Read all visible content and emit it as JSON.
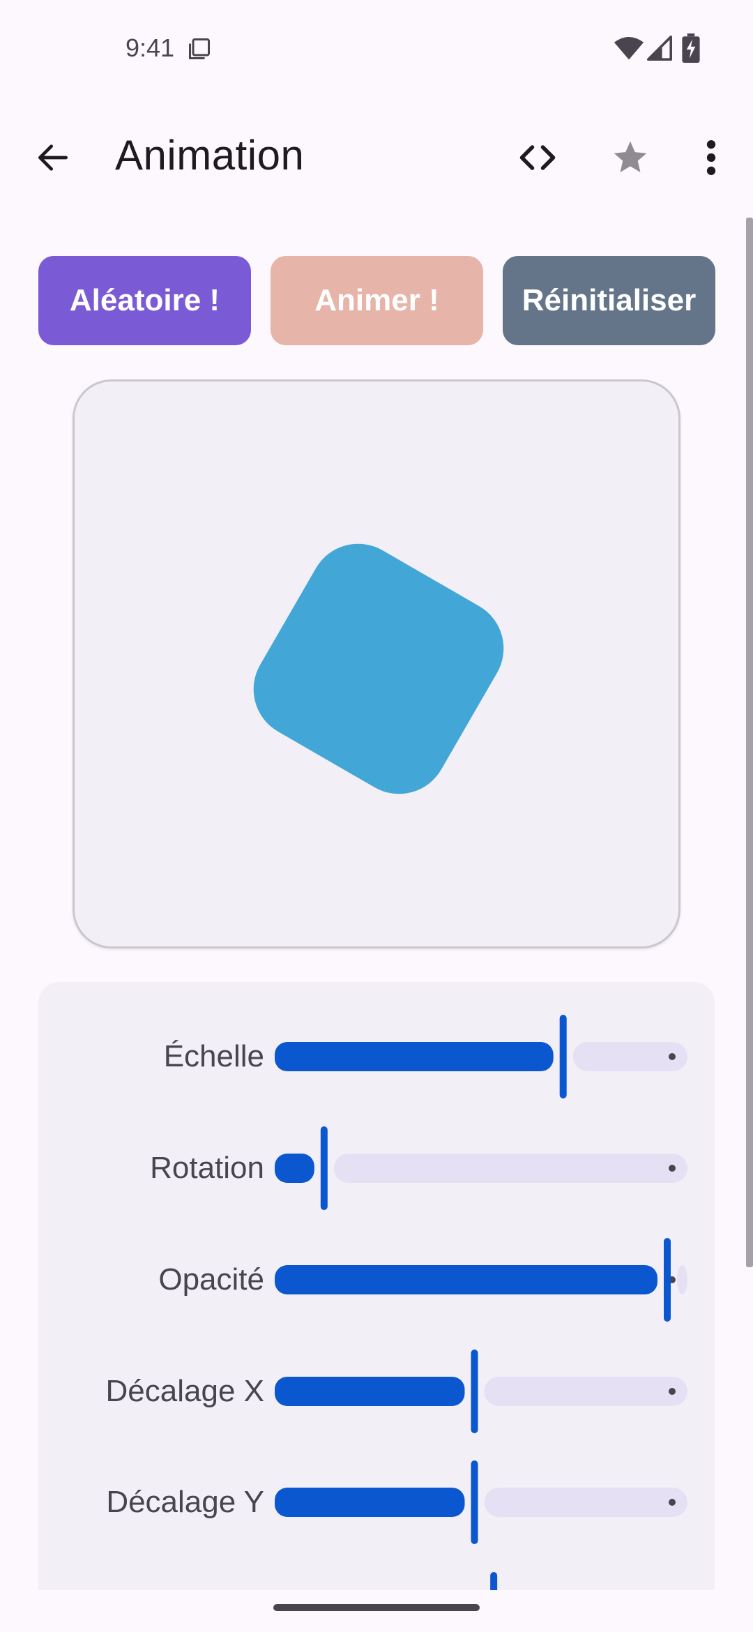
{
  "status_bar": {
    "time": "9:41",
    "icons": [
      "notification-icon",
      "wifi-icon",
      "signal-icon",
      "battery-charging-icon"
    ]
  },
  "app_bar": {
    "title": "Animation",
    "back_icon": "arrow-left-icon",
    "code_icon": "code-icon",
    "favorite_icon": "star-icon",
    "more_icon": "more-vertical-icon"
  },
  "actions": {
    "random_label": "Aléatoire !",
    "animate_label": "Animer !",
    "reset_label": "Réinitialiser"
  },
  "colors": {
    "random": "#7b5ad5",
    "animate": "#e6b4a8",
    "reset": "#647589",
    "shape": "#42a6d6",
    "slider_active": "#0b57d0",
    "slider_inactive": "#e6e0f5"
  },
  "preview": {
    "shape": "rounded-square",
    "rotation_deg": 30
  },
  "controls": [
    {
      "label": "Échelle",
      "value": 0.73
    },
    {
      "label": "Rotation",
      "value": 0.11
    },
    {
      "label": "Opacité",
      "value": 1.0
    },
    {
      "label": "Décalage X",
      "value": 0.5
    },
    {
      "label": "Décalage Y",
      "value": 0.5
    },
    {
      "label": "",
      "value": 0.55
    }
  ]
}
